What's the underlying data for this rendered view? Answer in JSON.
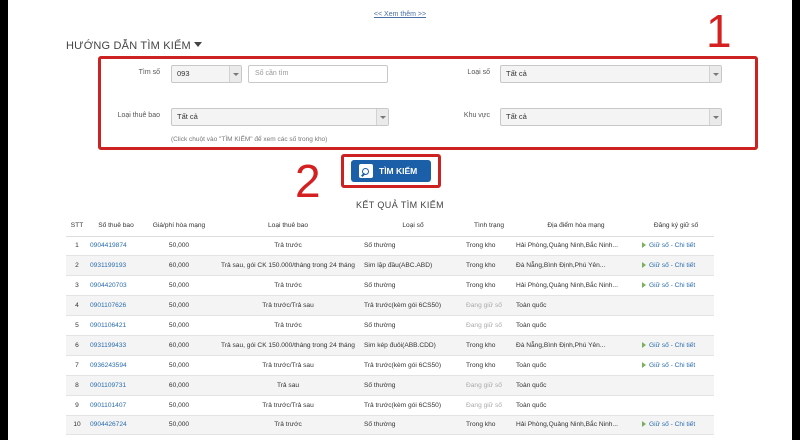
{
  "see_more": "<< Xem thêm >>",
  "guide_title": "HƯỚNG DẪN TÌM KIẾM",
  "annotations": {
    "step1": "1",
    "step2": "2"
  },
  "form": {
    "search_label": "Tìm số",
    "prefix_value": "093",
    "number_placeholder": "Số cần tìm",
    "sim_type_label": "Loại số",
    "sim_type_value": "Tất cả",
    "subscriber_type_label": "Loại thuê bao",
    "subscriber_type_value": "Tất cả",
    "region_label": "Khu vực",
    "region_value": "Tất cả",
    "hint": "(Click chuột vào \"TÌM KIẾM\" để xem các số trong kho)"
  },
  "search_button": "TÌM KIẾM",
  "results_title": "KẾT QUẢ TÌM KIẾM",
  "table": {
    "headers": [
      "STT",
      "Số thuê bao",
      "Giá/phí hòa mạng",
      "Loại thuê bao",
      "Loại số",
      "Tình trạng",
      "Địa điểm hòa mạng",
      "Đăng ký giữ số"
    ],
    "rows": [
      {
        "stt": "1",
        "number": "0904419874",
        "fee": "50,000",
        "sub_type": "Trả trước",
        "sim_type": "Số thường",
        "status": "Trong kho",
        "location": "Hải Phòng,Quảng Ninh,Bắc Ninh...",
        "register": "Giữ số - Chi tiết"
      },
      {
        "stt": "2",
        "number": "0931199193",
        "fee": "60,000",
        "sub_type": "Trả sau, gói CK 150.000/tháng trong 24 tháng",
        "sim_type": "Sim lặp đầu(ABC.ABD)",
        "status": "Trong kho",
        "location": "Đà Nẵng,Bình Định,Phú Yên...",
        "register": "Giữ số - Chi tiết"
      },
      {
        "stt": "3",
        "number": "0904420703",
        "fee": "50,000",
        "sub_type": "Trả trước",
        "sim_type": "Số thường",
        "status": "Trong kho",
        "location": "Hải Phòng,Quảng Ninh,Bắc Ninh...",
        "register": "Giữ số - Chi tiết"
      },
      {
        "stt": "4",
        "number": "0901107626",
        "fee": "50,000",
        "sub_type": "Trả trước/Trả sau",
        "sim_type": "Trả trước(kèm gói 6CS50)",
        "status": "Đang giữ số",
        "location": "Toàn quốc",
        "register": ""
      },
      {
        "stt": "5",
        "number": "0901106421",
        "fee": "50,000",
        "sub_type": "Trả trước",
        "sim_type": "Số thường",
        "status": "Đang giữ số",
        "location": "Toàn quốc",
        "register": ""
      },
      {
        "stt": "6",
        "number": "0931199433",
        "fee": "60,000",
        "sub_type": "Trả sau, gói CK 150.000/tháng trong 24 tháng",
        "sim_type": "Sim kép đuôi(ABB.CDD)",
        "status": "Trong kho",
        "location": "Đà Nẵng,Bình Định,Phú Yên...",
        "register": "Giữ số - Chi tiết"
      },
      {
        "stt": "7",
        "number": "0936243594",
        "fee": "50,000",
        "sub_type": "Trả trước/Trả sau",
        "sim_type": "Trả trước(kèm gói 6CS50)",
        "status": "Trong kho",
        "location": "Toàn quốc",
        "register": "Giữ số - Chi tiết"
      },
      {
        "stt": "8",
        "number": "0901109731",
        "fee": "60,000",
        "sub_type": "Trả sau",
        "sim_type": "Số thường",
        "status": "Đang giữ số",
        "location": "Toàn quốc",
        "register": ""
      },
      {
        "stt": "9",
        "number": "0901101407",
        "fee": "50,000",
        "sub_type": "Trả trước/Trả sau",
        "sim_type": "Trả trước(kèm gói 6CS50)",
        "status": "Đang giữ số",
        "location": "Toàn quốc",
        "register": ""
      },
      {
        "stt": "10",
        "number": "0904426724",
        "fee": "50,000",
        "sub_type": "Trả trước",
        "sim_type": "Số thường",
        "status": "Trong kho",
        "location": "Hải Phòng,Quảng Ninh,Bắc Ninh...",
        "register": "Giữ số - Chi tiết"
      }
    ]
  },
  "colors": {
    "annotation_red": "#cc2222",
    "button_blue": "#1a5fa8",
    "link_blue": "#2a6db0"
  }
}
